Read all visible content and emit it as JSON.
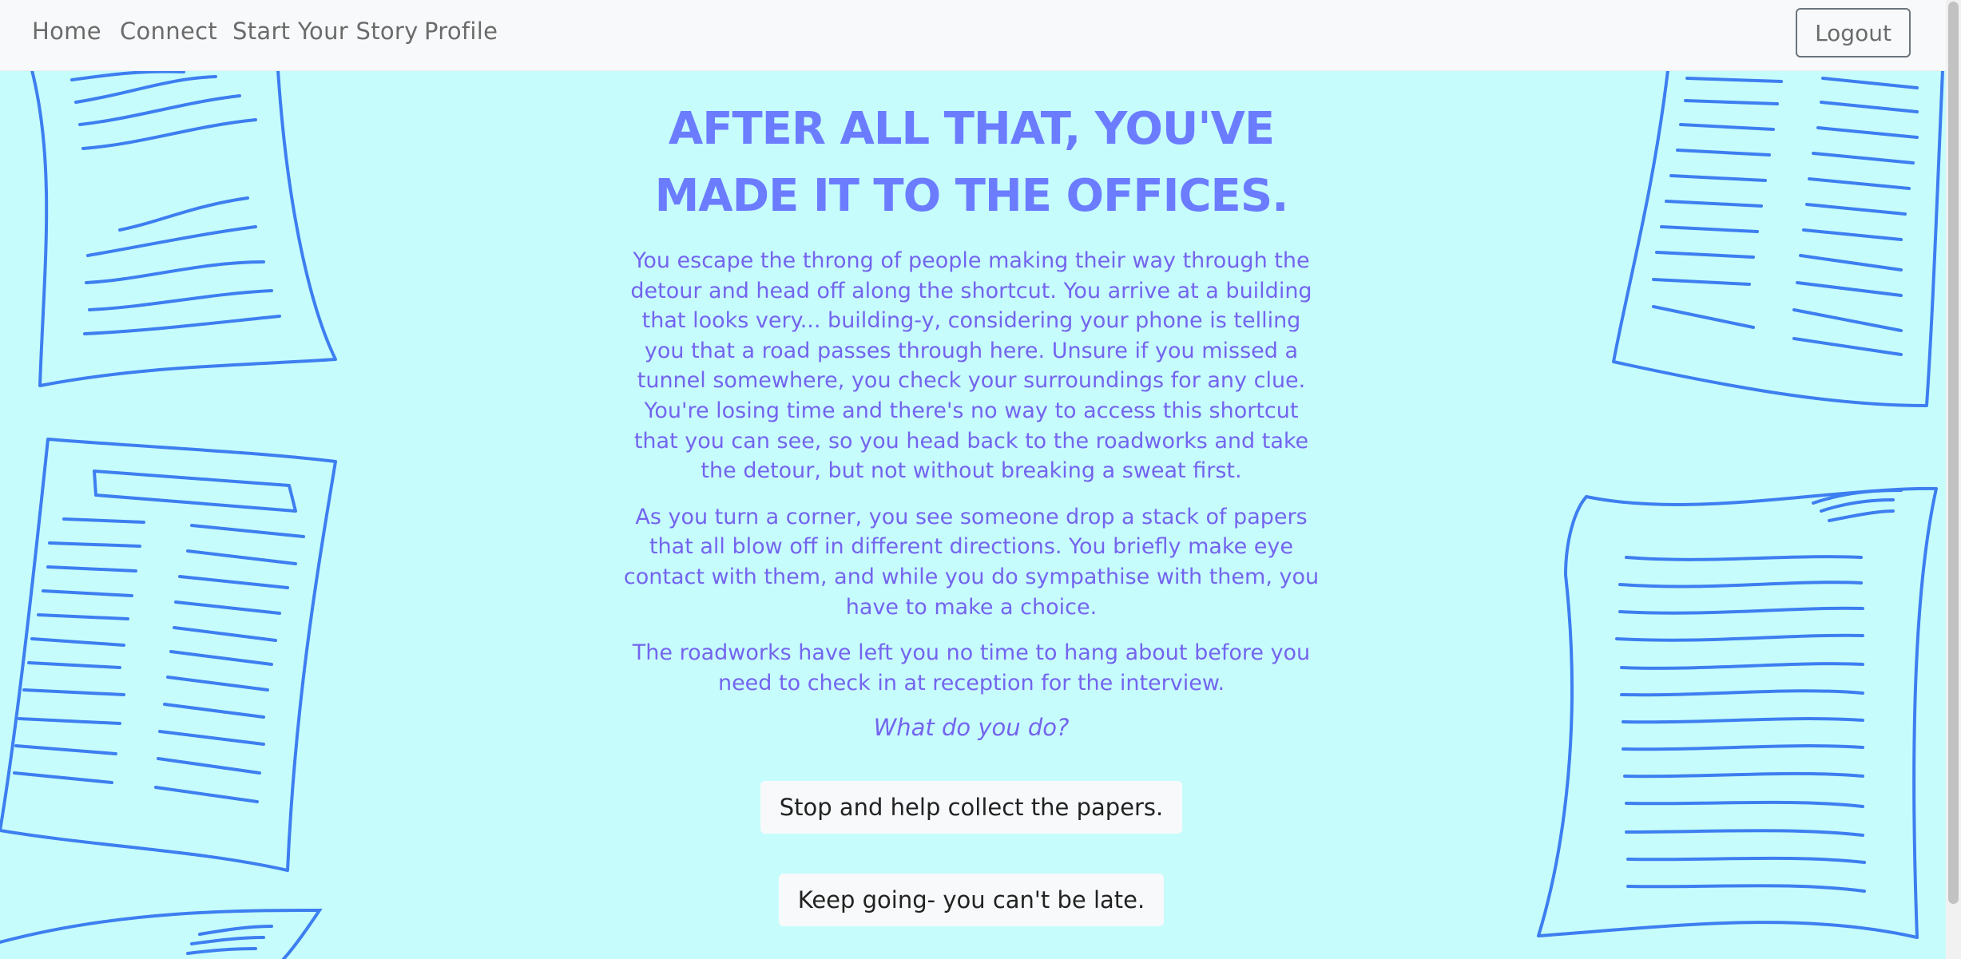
{
  "nav": {
    "home": "Home",
    "connect": "Connect",
    "start_story": "Start Your Story",
    "profile": "Profile",
    "logout": "Logout"
  },
  "story": {
    "title": "After all that, you've made it to the offices.",
    "paragraphs": [
      "You escape the throng of people making their way through the detour and head off along the shortcut. You arrive at a building that looks very... building-y, considering your phone is telling you that a road passes through here. Unsure if you missed a tunnel somewhere, you check your surroundings for any clue. You're losing time and there's no way to access this shortcut that you can see, so you head back to the roadworks and take the detour, but not without breaking a sweat first.",
      "As you turn a corner, you see someone drop a stack of papers that all blow off in different directions. You briefly make eye contact with them, and while you do sympathise with them, you have to make a choice.",
      "The roadworks have left you no time to hang about before you need to check in at reception for the interview."
    ],
    "question": "What do you do?",
    "choices": [
      "Stop and help collect the papers.",
      "Keep going- you can't be late."
    ]
  },
  "colors": {
    "background": "#c6fdfc",
    "title": "#6b7cff",
    "body_text": "#7464ee",
    "paper_stroke": "#3d7ef0"
  }
}
